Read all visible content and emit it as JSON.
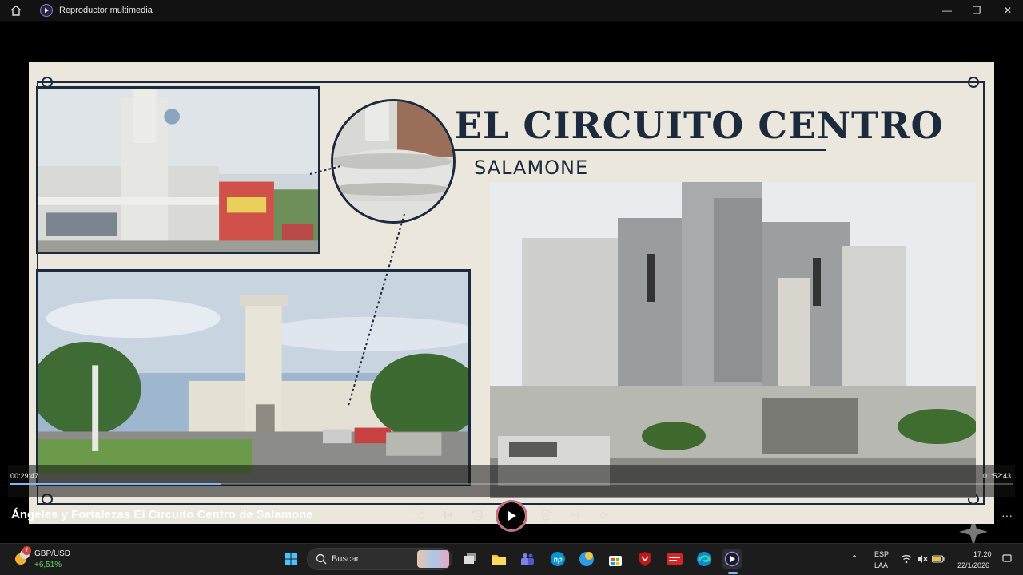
{
  "window": {
    "title": "Reproductor multimedia",
    "minimize": "—",
    "maximize": "❐",
    "close": "✕"
  },
  "slide": {
    "title": "EL CIRCUITO CENTRO",
    "subtitle": "SALAMONE"
  },
  "player": {
    "elapsed": "00:29:47",
    "remaining": "01:52:43",
    "progress": 0.21,
    "media_title": "Ángeles y Fortalezas El Circuito Centro de Salamone",
    "controls": {
      "shuffle": "⤮",
      "previous": "⏮",
      "rewind": "10",
      "forward": "30",
      "next": "⏭",
      "repeat": "⟳",
      "more": "···"
    }
  },
  "taskbar": {
    "weather_badge": "7",
    "weather_label": "GBP/USD",
    "weather_value": "+6,51%",
    "search_placeholder": "Buscar",
    "language_top": "ESP",
    "language_bottom": "LAA",
    "time": "17:20",
    "date": "22/1/2026",
    "chevron": "⌃"
  },
  "colors": {
    "slide_navy": "#1b2a3d",
    "slide_bg": "#ece7dc",
    "accent_play": "#c46aa8",
    "weather_positive": "#5fd35f"
  }
}
